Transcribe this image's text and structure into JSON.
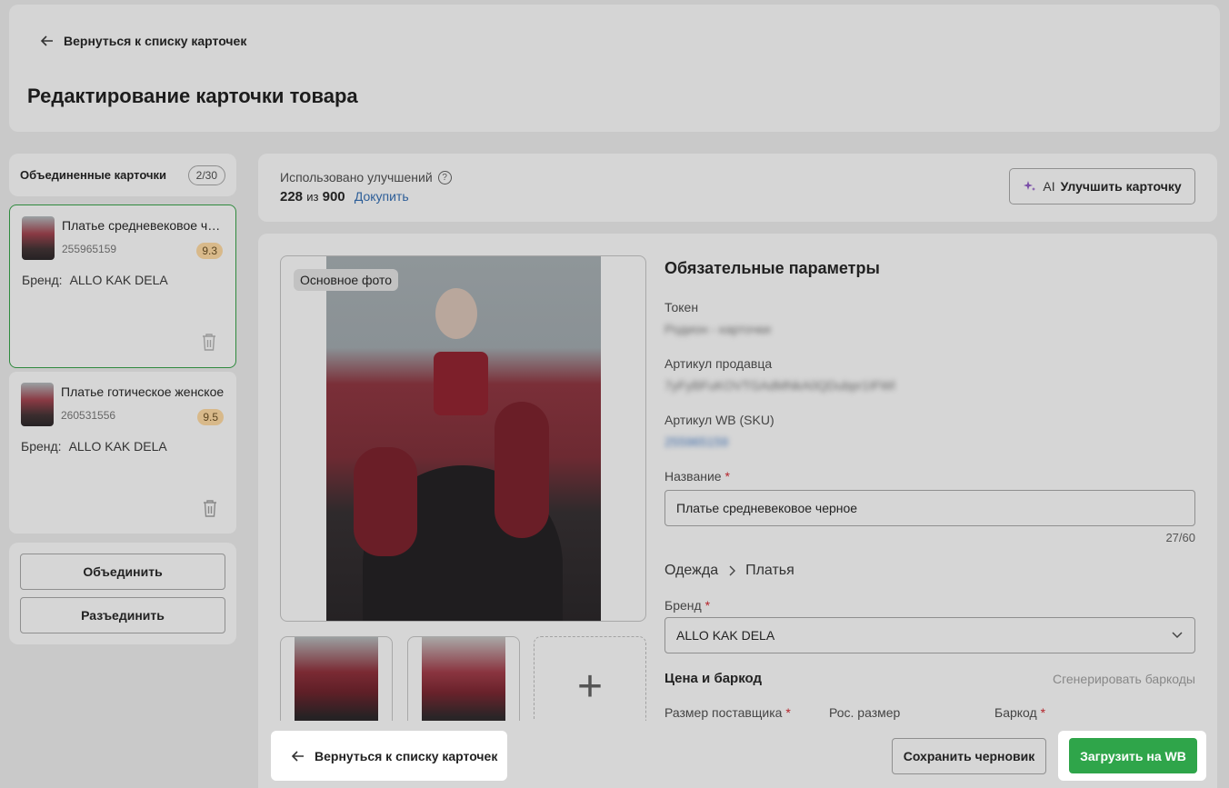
{
  "header": {
    "back_label": "Вернуться к списку карточек",
    "title": "Редактирование карточки товара"
  },
  "sidebar": {
    "merged_title": "Объединенные карточки",
    "merged_count": "2/30",
    "brand_label": "Бренд:",
    "cards": [
      {
        "name": "Платье средневековое черное",
        "sku": "255965159",
        "score": "9.3",
        "brand": "ALLO KAK DELA"
      },
      {
        "name": "Платье готическое женское",
        "sku": "260531556",
        "score": "9.5",
        "brand": "ALLO KAK DELA"
      }
    ],
    "merge_label": "Объединить",
    "unmerge_label": "Разъединить"
  },
  "improvements": {
    "label": "Использовано улучшений",
    "used": "228",
    "of_text": "из",
    "total": "900",
    "buy_more": "Докупить",
    "ai_prefix": "AI",
    "ai_button": "Улучшить карточку"
  },
  "photos": {
    "main_badge": "Основное фото",
    "add_symbol": "+"
  },
  "params": {
    "title": "Обязательные параметры",
    "token_label": "Токен",
    "token_value": "Родион - карточки",
    "seller_sku_label": "Артикул продавца",
    "seller_sku_value": "7yFyBFuKOVTGAdMNkA0QDubpr1IFWl",
    "wb_sku_label": "Артикул WB (SKU)",
    "wb_sku_value": "255965159",
    "name_label": "Название",
    "name_value": "Платье средневековое черное",
    "name_count": "27/60",
    "category_parent": "Одежда",
    "category_child": "Платья",
    "brand_label": "Бренд",
    "brand_value": "ALLO KAK DELA",
    "price_title": "Цена и баркод",
    "generate_barcodes": "Сгенерировать баркоды",
    "supplier_size_label": "Размер поставщика",
    "ru_size_label": "Рос. размер",
    "barcode_label": "Баркод",
    "required_mark": "*"
  },
  "footer": {
    "back_label": "Вернуться к списку карточек",
    "save_draft": "Сохранить черновик",
    "upload": "Загрузить на WB"
  },
  "colors": {
    "accent_green": "#2fa54a",
    "link_blue": "#2d5e98",
    "required_red": "#b5242b"
  }
}
